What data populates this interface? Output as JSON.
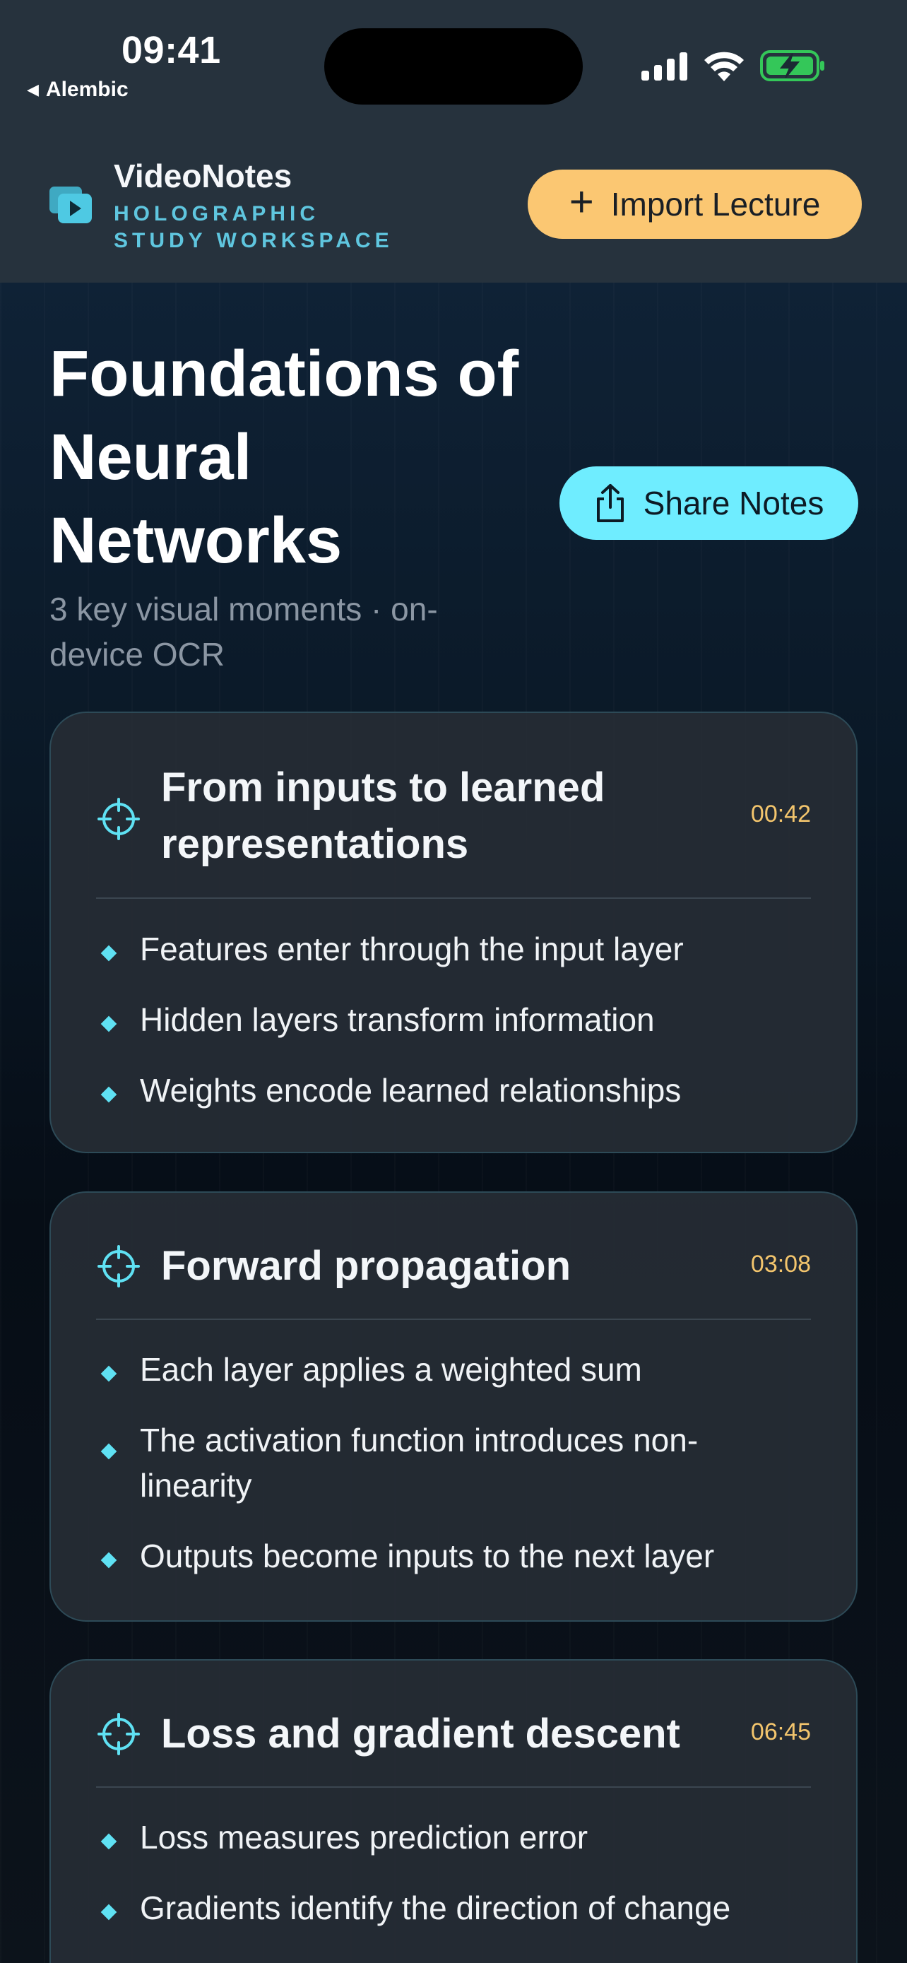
{
  "status_bar": {
    "time": "09:41",
    "back_app": "Alembic",
    "signal_icon": "cellular-signal-icon",
    "wifi_icon": "wifi-icon",
    "battery_icon": "battery-charging-icon",
    "battery_color": "#34c759"
  },
  "header": {
    "app_name": "VideoNotes",
    "tagline_line1": "HOLOGRAPHIC",
    "tagline_line2": "STUDY WORKSPACE",
    "logo_icon": "video-stack-icon",
    "import_label": "Import Lecture",
    "import_icon": "plus-icon"
  },
  "lecture": {
    "title": "Foundations of Neural Networks",
    "subtitle": "3 key visual moments · on-device OCR",
    "share_label": "Share Notes",
    "share_icon": "share-icon"
  },
  "moments": [
    {
      "title": "From inputs to learned representations",
      "timestamp": "00:42",
      "bullets": [
        "Features enter through the input layer",
        "Hidden layers transform information",
        "Weights encode learned relationships"
      ]
    },
    {
      "title": "Forward propagation",
      "timestamp": "03:08",
      "bullets": [
        "Each layer applies a weighted sum",
        "The activation function introduces non-linearity",
        "Outputs become inputs to the next layer"
      ]
    },
    {
      "title": "Loss and gradient descent",
      "timestamp": "06:45",
      "bullets": [
        "Loss measures prediction error",
        "Gradients identify the direction of change"
      ]
    }
  ],
  "colors": {
    "accent_cyan": "#6fedff",
    "accent_amber": "#fbc772",
    "timestamp": "#f3c56d",
    "bullet": "#5fe1f3"
  }
}
